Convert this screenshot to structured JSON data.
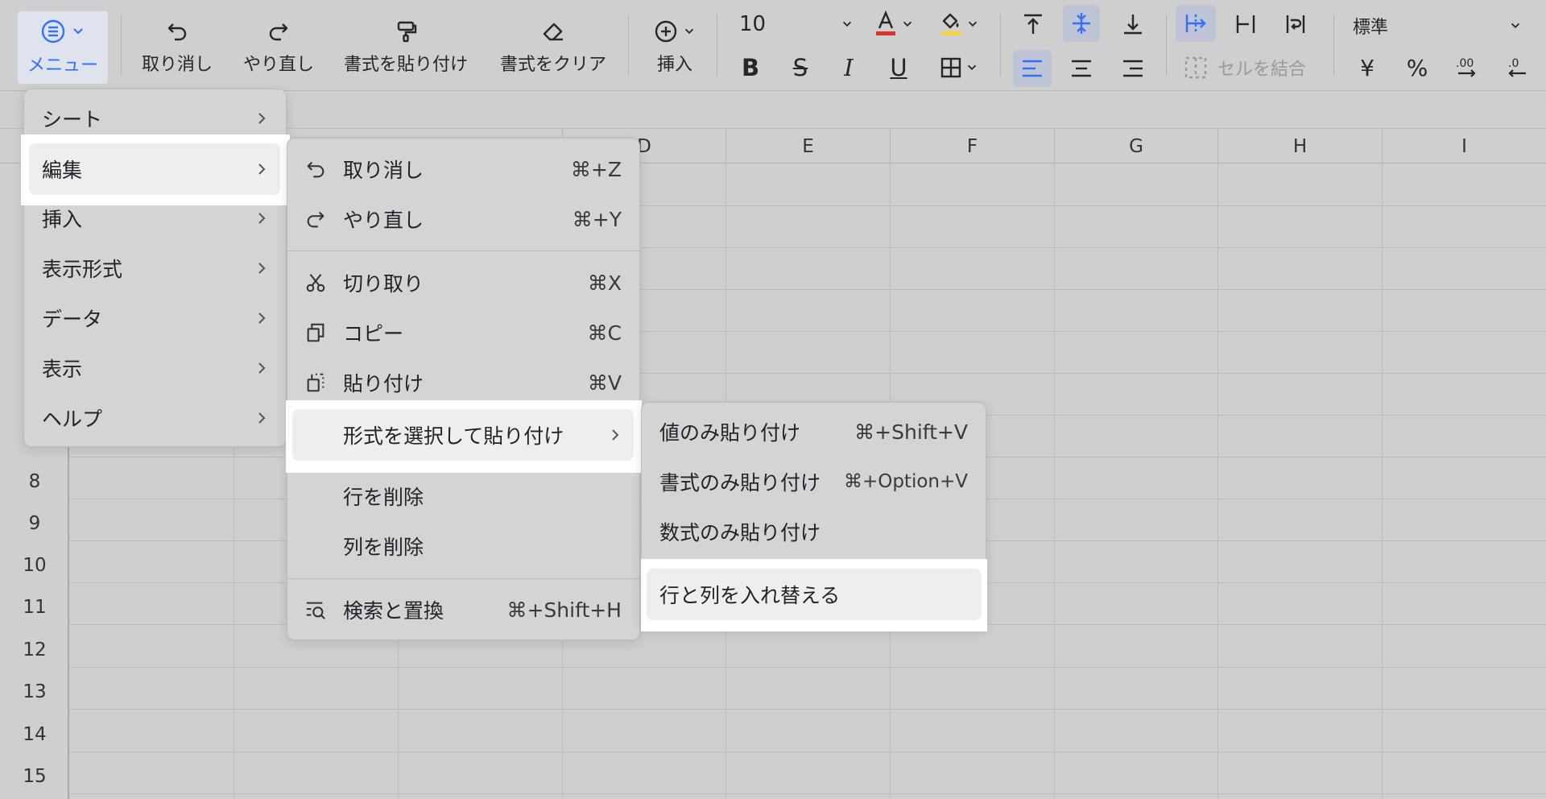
{
  "toolbar": {
    "menu_label": "メニュー",
    "undo_label": "取り消し",
    "redo_label": "やり直し",
    "paste_format_label": "書式を貼り付け",
    "clear_format_label": "書式をクリア",
    "insert_label": "挿入",
    "font_size": "10",
    "merge_label": "セルを結合",
    "number_format": "標準",
    "currency_symbol": "¥",
    "percent_symbol": "%",
    "font_color": "#d9342b",
    "fill_color": "#f2d43d",
    "accent_color": "#3370ff"
  },
  "columns": [
    "D",
    "E",
    "F",
    "G",
    "H",
    "I"
  ],
  "rows": [
    "8",
    "9",
    "10",
    "11",
    "12",
    "13",
    "14",
    "15"
  ],
  "main_menu": {
    "items": [
      {
        "label": "シート"
      },
      {
        "label": "編集"
      },
      {
        "label": "挿入"
      },
      {
        "label": "表示形式"
      },
      {
        "label": "データ"
      },
      {
        "label": "表示"
      },
      {
        "label": "ヘルプ"
      }
    ]
  },
  "edit_menu": {
    "undo": {
      "label": "取り消し",
      "shortcut": "⌘+Z",
      "icon": "undo-icon"
    },
    "redo": {
      "label": "やり直し",
      "shortcut": "⌘+Y",
      "icon": "redo-icon"
    },
    "cut": {
      "label": "切り取り",
      "shortcut": "⌘X",
      "icon": "scissors-icon"
    },
    "copy": {
      "label": "コピー",
      "shortcut": "⌘C",
      "icon": "copy-icon"
    },
    "paste": {
      "label": "貼り付け",
      "shortcut": "⌘V",
      "icon": "paste-icon"
    },
    "paste_special": {
      "label": "形式を選択して貼り付け"
    },
    "delete_row": {
      "label": "行を削除"
    },
    "delete_column": {
      "label": "列を削除"
    },
    "find_replace": {
      "label": "検索と置換",
      "shortcut": "⌘+Shift+H",
      "icon": "find-replace-icon"
    }
  },
  "paste_menu": {
    "values_only": {
      "label": "値のみ貼り付け",
      "shortcut": "⌘+Shift+V"
    },
    "format_only": {
      "label": "書式のみ貼り付け",
      "shortcut": "⌘+Option+V"
    },
    "formula_only": {
      "label": "数式のみ貼り付け"
    },
    "transpose": {
      "label": "行と列を入れ替える"
    }
  }
}
